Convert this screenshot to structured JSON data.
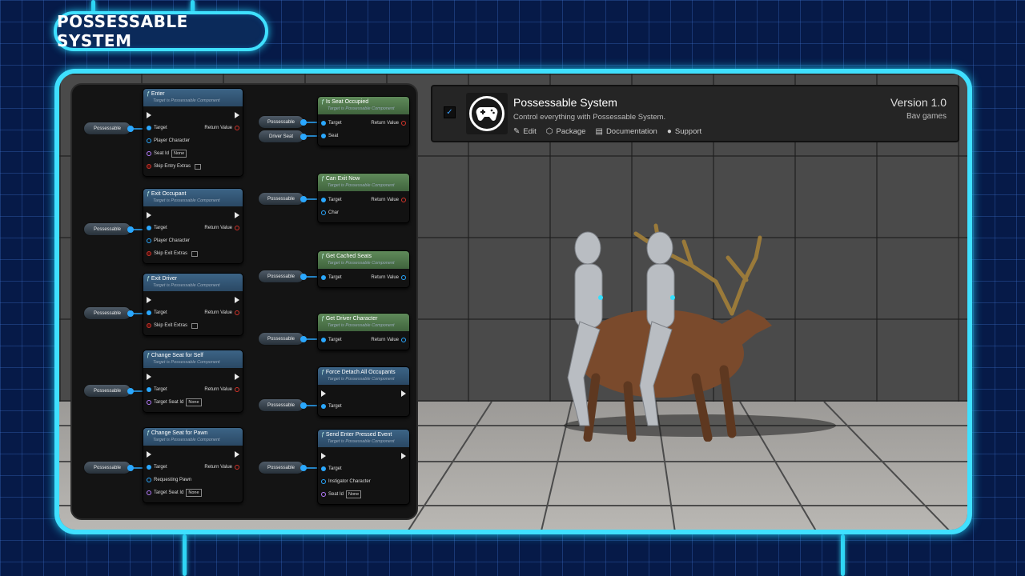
{
  "title": "POSSESSABLE SYSTEM",
  "colors": {
    "accent": "#3fe0ff",
    "node_header_blue": "#3c6486",
    "node_header_green": "#5f8a5a",
    "pin_blue": "#2aa8ff"
  },
  "blueprint": {
    "target_sub": "Target is Possessable Component",
    "var_possessable": "Possessable",
    "var_driver_seat": "Driver Seat",
    "target": "Target",
    "return_value": "Return Value",
    "none": "None",
    "nodes": {
      "enter": {
        "title": "Enter",
        "player_character": "Player Character",
        "seat_id": "Seat Id",
        "skip": "Skip Entry Extras"
      },
      "exit_occupant": {
        "title": "Exit Occupant",
        "player_character": "Player Character",
        "skip": "Skip Exit Extras"
      },
      "exit_driver": {
        "title": "Exit Driver",
        "skip": "Skip Exit Extras"
      },
      "change_seat_self": {
        "title": "Change Seat for Self",
        "target_seat_id": "Target Seat Id"
      },
      "change_seat_pawn": {
        "title": "Change Seat for Pawn",
        "requesting_pawn": "Requesting Pawn",
        "target_seat_id": "Target Seat Id"
      },
      "is_seat_occupied": {
        "title": "Is Seat Occupied",
        "seat": "Seat"
      },
      "can_exit_now": {
        "title": "Can Exit Now",
        "char": "Char"
      },
      "get_cached_seats": {
        "title": "Get Cached Seats"
      },
      "get_driver_character": {
        "title": "Get Driver Character"
      },
      "force_detach": {
        "title": "Force Detach All Occupants"
      },
      "send_enter": {
        "title": "Send Enter Pressed Event",
        "instigator": "Instigator Character",
        "seat_id": "Seat Id"
      }
    }
  },
  "plugin": {
    "enabled": true,
    "icon": "gamepad-icon",
    "name": "Possessable System",
    "description": "Control everything with Possessable System.",
    "links": {
      "edit": "Edit",
      "package": "Package",
      "documentation": "Documentation",
      "support": "Support"
    },
    "version": "Version 1.0",
    "author": "Bav games"
  }
}
